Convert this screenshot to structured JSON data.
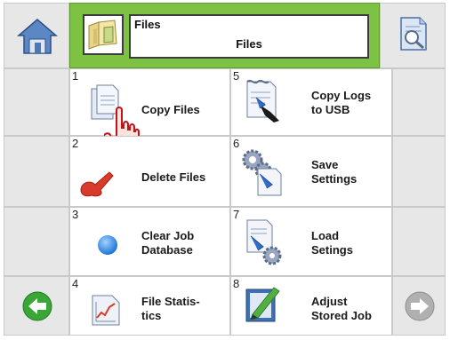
{
  "header": {
    "title_small": "Files",
    "title_main": "Files"
  },
  "menu": [
    {
      "num": "1",
      "label": "Copy Files"
    },
    {
      "num": "2",
      "label": "Delete Files"
    },
    {
      "num": "3",
      "label": "Clear Job\nDatabase"
    },
    {
      "num": "4",
      "label": "File Statis-\ntics"
    },
    {
      "num": "5",
      "label": "Copy Logs\nto USB"
    },
    {
      "num": "6",
      "label": "Save\nSettings"
    },
    {
      "num": "7",
      "label": "Load\nSetings"
    },
    {
      "num": "8",
      "label": "Adjust\nStored Job"
    }
  ],
  "icons": {
    "home": "home-icon",
    "folder": "folder-icon",
    "preview": "document-preview-icon",
    "back": "back-arrow-icon",
    "forward": "forward-arrow-icon",
    "cursor": "hand-cursor-icon"
  },
  "colors": {
    "header_green": "#7dc242",
    "back_green": "#3aa635",
    "forward_grey": "#b0b0b0",
    "grid_line": "#c9c9c9"
  }
}
